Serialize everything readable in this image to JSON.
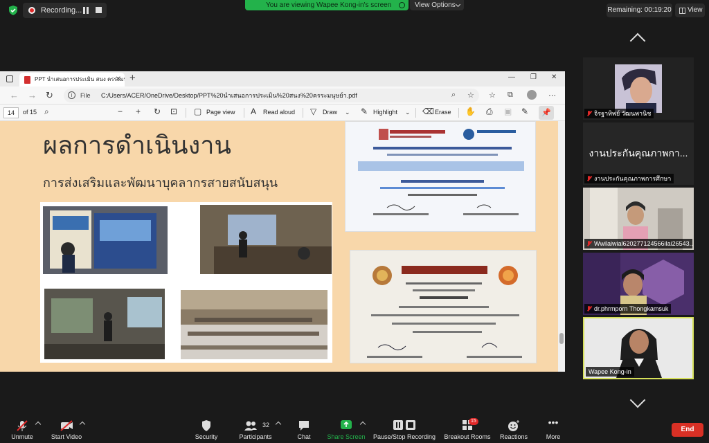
{
  "top": {
    "recording_label": "Recording...",
    "viewing_text": "You are viewing Wapee Kong-in's screen",
    "view_options": "View Options",
    "remaining": "Remaining: 00:19:20",
    "view_label": "View"
  },
  "browser": {
    "tab_title": "PPT นำเสนอการประเมิน สนง ครระมนุษย์.pdf",
    "file_label": "File",
    "url": "C:/Users/ACER/OneDrive/Desktop/PPT%20นำเสนอการประเมิน%20สนง%20ครระมนุษย์า.pdf"
  },
  "pdf_toolbar": {
    "page_current": "14",
    "page_total": "of 15",
    "page_view": "Page view",
    "read_aloud": "Read aloud",
    "draw": "Draw",
    "highlight": "Highlight",
    "erase": "Erase"
  },
  "slide": {
    "title": "ผลการดำเนินงาน",
    "subtitle": "การส่งเสริมและพัฒนาบุคลากรสายสนับสนุน"
  },
  "participants": [
    {
      "name": "จิรฐาทิพย์ วัฒนพานิช",
      "muted": true
    },
    {
      "name": "งานประกันคุณภาพการศึกษา",
      "display": "งานประกันคุณภาพกา...",
      "muted": true
    },
    {
      "name": "Wwilaiwial620277124566ilai26543...",
      "muted": true
    },
    {
      "name": "dr.phrmporn Thongkamsuk",
      "muted": true
    },
    {
      "name": "Wapee Kong-in",
      "muted": false
    }
  ],
  "toolbar": {
    "unmute": "Unmute",
    "start_video": "Start Video",
    "security": "Security",
    "participants": "Participants",
    "participant_count": "32",
    "chat": "Chat",
    "share_screen": "Share Screen",
    "pause_stop_recording": "Pause/Stop Recording",
    "breakout_rooms": "Breakout Rooms",
    "breakout_badge": "15",
    "reactions": "Reactions",
    "more": "More",
    "end": "End"
  },
  "colors": {
    "share_green": "#23b24b",
    "end_red": "#d93025",
    "active_speaker": "#d6e05a",
    "slide_bg": "#f8d7aa"
  }
}
